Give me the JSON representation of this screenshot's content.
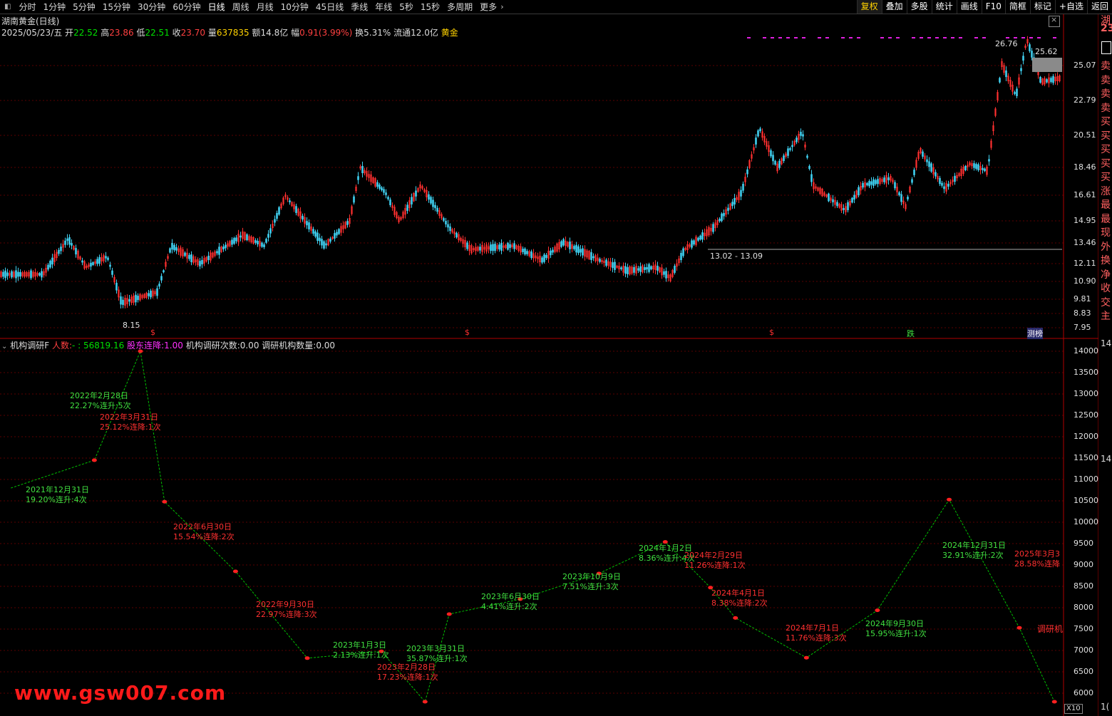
{
  "toolbar": {
    "tabs": [
      "分时",
      "1分钟",
      "5分钟",
      "15分钟",
      "30分钟",
      "60分钟",
      "日线",
      "周线",
      "月线",
      "10分钟",
      "45日线",
      "季线",
      "年线",
      "5秒",
      "15秒",
      "多周期",
      "更多"
    ],
    "active_tab": "日线",
    "right_buttons": [
      "复权",
      "叠加",
      "多股",
      "统计",
      "画线",
      "F10",
      "简框",
      "标记",
      "+自选",
      "返回"
    ]
  },
  "stock": {
    "title": "湖南黄金(日线)",
    "date": "2025/05/23/五",
    "open_label": "开",
    "open": "22.52",
    "high_label": "高",
    "high": "23.86",
    "low_label": "低",
    "low": "22.51",
    "close_label": "收",
    "close": "23.70",
    "vol_label": "量",
    "vol": "637835",
    "amount_label": "额",
    "amount": "14.8亿",
    "change_label": "幅",
    "change": "0.91(3.99%)",
    "turnover_label": "换",
    "turnover": "5.31%",
    "float_label": "流通",
    "float": "12.0亿",
    "sector": "黄金"
  },
  "main_axis": [
    "25.07",
    "22.79",
    "20.51",
    "18.46",
    "16.61",
    "14.95",
    "13.46",
    "12.11",
    "10.90",
    "9.81",
    "8.83",
    "7.95"
  ],
  "price_labels": {
    "high_left": "26.76",
    "high_right": "25.62",
    "low": "8.15",
    "range": "13.02 - 13.09"
  },
  "event_markers": [
    {
      "text": "$",
      "color": "#ff3030"
    },
    {
      "text": "$",
      "color": "#ff3030"
    },
    {
      "text": "$",
      "color": "#ff3030"
    },
    {
      "text": "跌",
      "color": "#40e040"
    },
    {
      "text": "测榜",
      "color": "#ffffff"
    }
  ],
  "indicator": {
    "name": "机构调研F",
    "people_label": "人数:",
    "people_value": "- : 56819.16",
    "holder_label": "股东连降:",
    "holder_value": "1.00",
    "count_label": "机构调研次数:",
    "count_value": "0.00",
    "inst_label": "调研机构数量:",
    "inst_value": "0.00"
  },
  "sub_axis": [
    "14000",
    "13500",
    "13000",
    "12500",
    "12000",
    "11500",
    "11000",
    "10500",
    "10000",
    "9500",
    "9000",
    "8500",
    "8000",
    "7500",
    "7000",
    "6500",
    "6000"
  ],
  "sub_corner": "X10",
  "side_panel": {
    "top": "湖",
    "price": "23",
    "chars": [
      "卖",
      "卖",
      "卖",
      "卖",
      "买",
      "买",
      "买",
      "买",
      "买",
      "涨",
      "最",
      "最",
      "现",
      "外",
      "换",
      "净",
      "收",
      "交",
      "主"
    ],
    "sub_chars": [
      "14",
      "14",
      "1("
    ]
  },
  "annotations": [
    {
      "date": "2021年12月31日",
      "detail": "19.20%连升:4次",
      "color": "green"
    },
    {
      "date": "2022年2月28日",
      "detail": "22.27%连升:5次",
      "color": "green"
    },
    {
      "date": "2022年3月31日",
      "detail": "25.12%连降:1次",
      "color": "red"
    },
    {
      "date": "2022年6月30日",
      "detail": "15.54%连降:2次",
      "color": "red"
    },
    {
      "date": "2022年9月30日",
      "detail": "22.97%连降:3次",
      "color": "red"
    },
    {
      "date": "2023年1月3日",
      "detail": "2.13%连升:1次",
      "color": "green"
    },
    {
      "date": "2023年2月28日",
      "detail": "17.23%连降:1次",
      "color": "red"
    },
    {
      "date": "2023年3月31日",
      "detail": "35.87%连升:1次",
      "color": "green"
    },
    {
      "date": "2023年6月30日",
      "detail": "4.41%连升:2次",
      "color": "green"
    },
    {
      "date": "2023年10月9日",
      "detail": "7.51%连升:3次",
      "color": "green"
    },
    {
      "date": "2024年1月2日",
      "detail": "8.36%连升:4次",
      "color": "green"
    },
    {
      "date": "2024年2月29日",
      "detail": "11.26%连降:1次",
      "color": "red"
    },
    {
      "date": "2024年4月1日",
      "detail": "8.38%连降:2次",
      "color": "red"
    },
    {
      "date": "2024年7月1日",
      "detail": "11.76%连降:3次",
      "color": "red"
    },
    {
      "date": "2024年9月30日",
      "detail": "15.95%连升:1次",
      "color": "green"
    },
    {
      "date": "2024年12月31日",
      "detail": "32.91%连升:2次",
      "color": "green"
    },
    {
      "date": "2025年3月3",
      "detail": "28.58%连降",
      "color": "red"
    }
  ],
  "side_note": "调研机",
  "watermark": "www.gsw007.com",
  "chart_data": {
    "type": "line",
    "name": "机构调研 股东人数",
    "x": [
      "2021-09",
      "2021-12-31",
      "2022-02-28",
      "2022-03-31",
      "2022-06-30",
      "2022-09-30",
      "2023-01-03",
      "2023-02-28",
      "2023-03-31",
      "2023-06-30",
      "2023-10-09",
      "2024-01-02",
      "2024-02-29",
      "2024-04-01",
      "2024-07-01",
      "2024-09-30",
      "2024-12-31",
      "2025-03-31",
      "2025-05"
    ],
    "values": [
      10800,
      11450,
      14000,
      10480,
      8850,
      6820,
      6980,
      5800,
      7850,
      8200,
      8800,
      9540,
      8470,
      7760,
      6830,
      7940,
      10530,
      7530,
      5800
    ],
    "ylim": [
      5800,
      14200
    ],
    "colors": {
      "line": "#00c000",
      "point": "#ff2020"
    }
  },
  "colors": {
    "up": "#ff3030",
    "down": "#40d0f0",
    "grid": "#5a0000",
    "frame": "#b00000"
  }
}
